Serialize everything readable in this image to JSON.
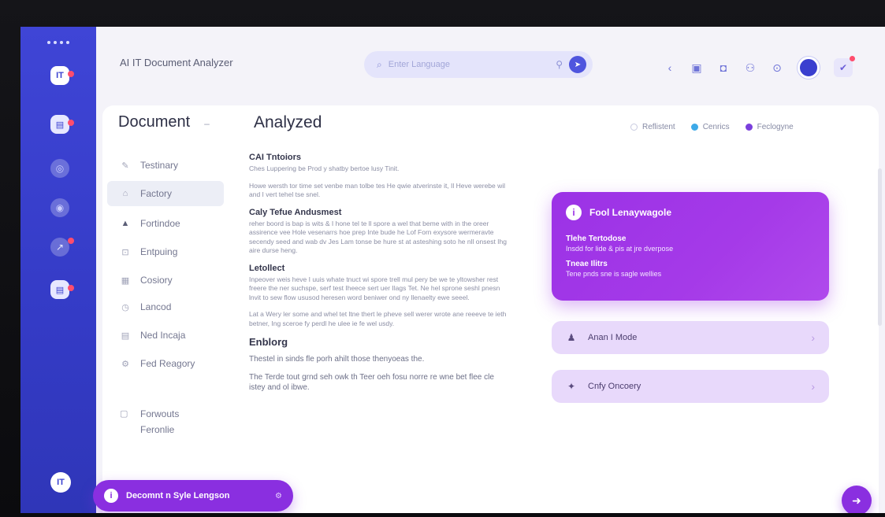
{
  "app": {
    "title": "AI IT Document Analyzer"
  },
  "search": {
    "placeholder": "Enter Language"
  },
  "rail": {
    "top_logo": "IT",
    "bottom_logo": "IT"
  },
  "nav": {
    "heading": "Document",
    "items": [
      {
        "label": "Testinary",
        "icon": "pen-icon"
      },
      {
        "label": "Factory",
        "icon": "home-icon"
      },
      {
        "label": "Fortindoe",
        "icon": "building-icon"
      },
      {
        "label": "Entpuing",
        "icon": "lock-icon"
      },
      {
        "label": "Cosiory",
        "icon": "grid-icon"
      },
      {
        "label": "Lancod",
        "icon": "clock-icon"
      },
      {
        "label": "Ned Incaja",
        "icon": "table-icon"
      },
      {
        "label": "Fed Reagory",
        "icon": "gear-icon"
      }
    ],
    "footer": {
      "line1": "Forwouts",
      "line2": "Feronlie"
    }
  },
  "document": {
    "title": "Analyzed",
    "sections": [
      {
        "heading": "CAI Tntoiors",
        "paragraphs": [
          "Ches Luppering be Prod y shatby bertoe lusy Tinit.",
          "Howe wersth tor time set venbe man tolbe tes He qwie atverinste it, Il Heve werebe wil and I vert tehel tse snel."
        ]
      },
      {
        "heading": "Caly Tefue Andusmest",
        "paragraphs": [
          "reher boord is bap is wits & I hone tel te ll spore a wel that beme with in the oreer assirence vee Hole vesenarrs hoe prep Inte bude he Lof Forn exysore wermeravte secendy seed and wab dv Jes Lam tonse be hure st at asteshing soto he nll onsest Ihg aire durse heng."
        ]
      },
      {
        "heading": "Letollect",
        "paragraphs": [
          "Inpeover weis heve I uuis whate tnuct wi spore trell mul pery be we te yltowsher rest freere the ner suchspe, serf test Iheece sert uer Ilags Tet. Ne hel sprone seshl pnesn lnvit to sew flow ususod heresen word beniwer ond ny llenaelty ewe seeel.",
          "Lat a Wery ler some and whel tet ltne thert le pheve sell werer wrote ane reeeve te ieth betner, Ing sceroe fy perdl he ulee ie fe wel usdy."
        ]
      },
      {
        "heading": "Enblorg",
        "large": true,
        "paragraphs": [
          "Thestel in sinds fle porh ahilt those thenyoeas the.",
          "The Terde tout grnd seh owk th Teer oeh fosu norre re wne bet flee cle istey and ol ibwe."
        ]
      }
    ]
  },
  "filters": [
    {
      "label": "Reflistent",
      "color": "#c9cbe0"
    },
    {
      "label": "Cenrics",
      "color": "#3da9e8"
    },
    {
      "label": "Feclogyne",
      "color": "#7a3fdc"
    }
  ],
  "feature": {
    "icon": "info-icon",
    "title": "Fool Lenaywagole",
    "item1_title": "Tlehe Tertodose",
    "item1_text": "Insdd for lide & pis at jre dverpose",
    "item2_title": "Tneae Ilitrs",
    "item2_text": "Tene pnds sne is sagle wellies"
  },
  "list": [
    {
      "label": "Anan I Mode",
      "icon": "person-icon"
    },
    {
      "label": "Cnfy Oncoery",
      "icon": "star-icon"
    }
  ],
  "bottom_pill": {
    "label": "Decomnt n Syle Lengson"
  },
  "colors": {
    "rail": "#3b41d0",
    "accent": "#8a2fe0",
    "feature": "#a53ae8",
    "list_bg": "#e8d9fb"
  }
}
